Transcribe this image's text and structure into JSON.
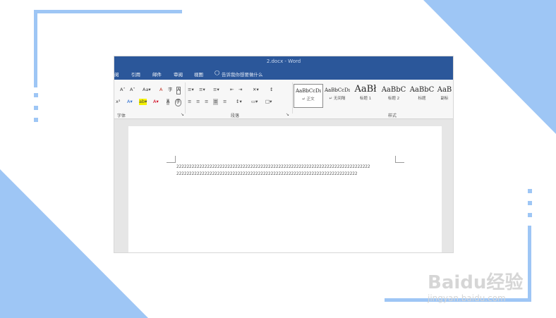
{
  "window": {
    "title": "2.docx  -  Word"
  },
  "menu": {
    "items": [
      "阅",
      "引用",
      "邮件",
      "审阅",
      "视图"
    ],
    "tell_me": "告诉我你想要做什么"
  },
  "ribbon": {
    "font_group_label": "字体",
    "paragraph_group_label": "段落",
    "styles_group_label": "样式",
    "font_tools_row1": [
      "A˄",
      "A˅",
      "Aa▾",
      "A",
      "字",
      "A"
    ],
    "font_tools_row2": [
      "x²",
      "A▾",
      "ab▾",
      "A▾",
      "A",
      "字"
    ],
    "styles": [
      {
        "preview": "AaBbCcDı",
        "label": "↵ 正文"
      },
      {
        "preview": "AaBbCcDı",
        "label": "↵ 无间隔"
      },
      {
        "preview": "AaBł",
        "label": "标题 1"
      },
      {
        "preview": "AaBbC",
        "label": "标题 2"
      },
      {
        "preview": "AaBbC",
        "label": "标题"
      },
      {
        "preview": "AaB",
        "label": "副标"
      }
    ]
  },
  "document": {
    "line1": "2222222222222222222222222222222222222222222222222222222222222222222222222222",
    "line2": "22222222222222222222222222222222222222222222222222222222222222222222222"
  },
  "watermark": {
    "logo": "Baidu经验",
    "url": "jingyan.baidu.com"
  },
  "colors": {
    "accent_blue": "#9ec6f5",
    "word_blue": "#2b579a"
  }
}
